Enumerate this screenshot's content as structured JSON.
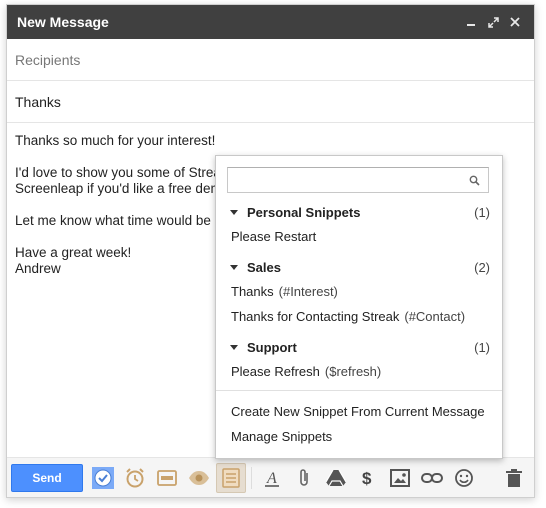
{
  "window": {
    "title": "New Message"
  },
  "fields": {
    "recipients_placeholder": "Recipients",
    "subject": "Thanks"
  },
  "body": {
    "line1": "Thanks so much for your interest!",
    "line2": "I'd love to show you some of Streak",
    "line3": "Screenleap if you'd like a free demo",
    "line4": "Let me know what time would be go",
    "line5": "Have a great week!",
    "line6": "Andrew"
  },
  "toolbar": {
    "send_label": "Send",
    "send_color": "#4d90fe",
    "icons": [
      "schedule-check-icon",
      "reminder-clock-icon",
      "template-icon",
      "tracking-eye-icon",
      "snippets-icon",
      "formatting-icon",
      "attach-icon",
      "drive-icon",
      "money-icon",
      "photo-icon",
      "link-icon",
      "emoji-icon",
      "trash-icon"
    ]
  },
  "snippets": {
    "search_value": "",
    "groups": [
      {
        "name": "Personal Snippets",
        "count": "(1)",
        "items": [
          {
            "label": "Please Restart",
            "tag": ""
          }
        ]
      },
      {
        "name": "Sales",
        "count": "(2)",
        "items": [
          {
            "label": "Thanks",
            "tag": "(#Interest)"
          },
          {
            "label": "Thanks for Contacting Streak",
            "tag": "(#Contact)"
          }
        ]
      },
      {
        "name": "Support",
        "count": "(1)",
        "items": [
          {
            "label": "Please Refresh",
            "tag": "($refresh)"
          }
        ]
      }
    ],
    "actions": {
      "create": "Create New Snippet From Current Message",
      "manage": "Manage Snippets"
    }
  }
}
